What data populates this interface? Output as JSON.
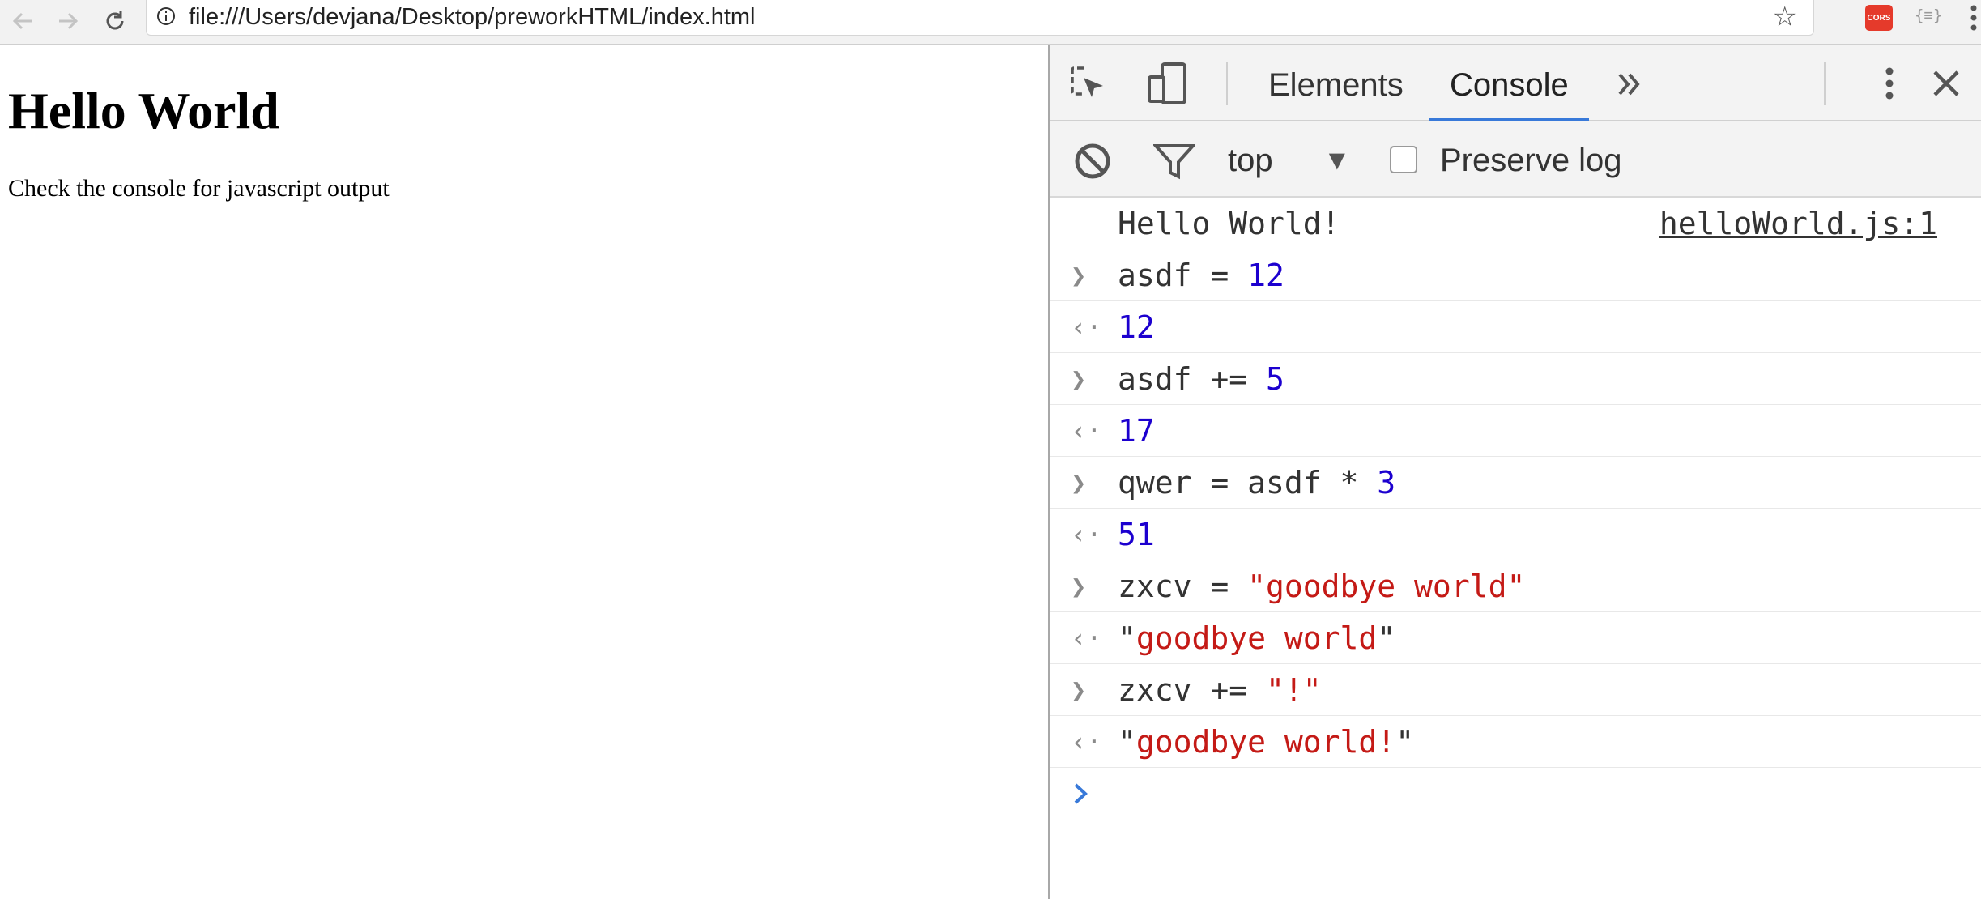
{
  "browser": {
    "url": "file:///Users/devjana/Desktop/preworkHTML/index.html",
    "extensions": {
      "cors_label": "CORS",
      "json_label": "{≡}"
    }
  },
  "page": {
    "heading": "Hello World",
    "text": "Check the console for javascript output"
  },
  "devtools": {
    "tabs": [
      {
        "label": "Elements"
      },
      {
        "label": "Console"
      }
    ],
    "active_tab": "Console",
    "context": "top",
    "preserve_log_label": "Preserve log",
    "preserve_log_checked": false,
    "console": {
      "log": {
        "text": "Hello World!",
        "source": "helloWorld.js:1"
      },
      "entries": [
        {
          "input": [
            "asdf = ",
            "12"
          ],
          "output": "12"
        },
        {
          "input": [
            "asdf += ",
            "5"
          ],
          "output": "17"
        },
        {
          "input": [
            "qwer = asdf * ",
            "3"
          ],
          "output": "51"
        },
        {
          "input": [
            "zxcv = ",
            "\"goodbye world\""
          ],
          "output_q1": "\"",
          "output_str": "goodbye world",
          "output_q2": "\""
        },
        {
          "input": [
            "zxcv += ",
            "\"!\""
          ],
          "output_q1": "\"",
          "output_str": "goodbye world!",
          "output_q2": "\""
        }
      ]
    },
    "colors": {
      "accent": "#3879d9",
      "number": "#1c00cf",
      "string": "#c41a16"
    }
  }
}
